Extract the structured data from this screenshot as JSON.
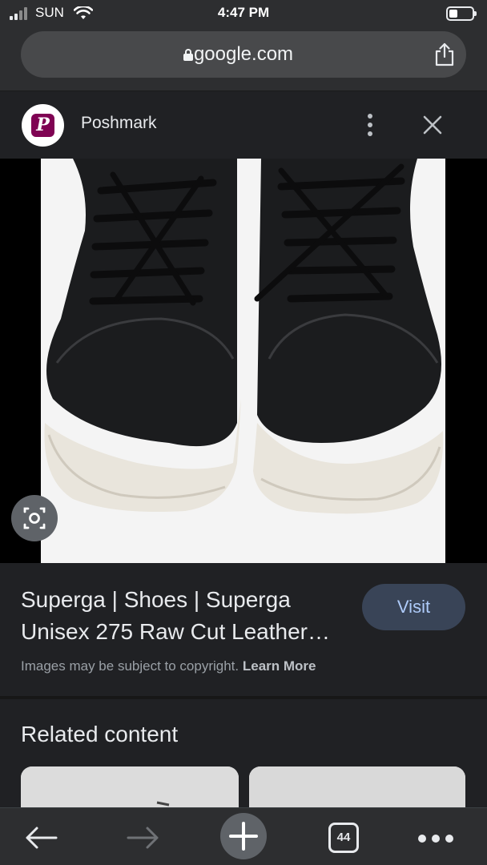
{
  "status_bar": {
    "carrier": "SUN",
    "time": "4:47 PM"
  },
  "address_bar": {
    "url": "google.com"
  },
  "source": {
    "name": "Poshmark",
    "logo_letter": "P",
    "brand_color": "#7f0353"
  },
  "image": {
    "subject": "black leather sneakers with white soles",
    "icon": "lens-icon"
  },
  "result": {
    "title_line1": "Superga | Shoes | Superga",
    "title_line2": "Unisex 275 Raw Cut Leather…",
    "visit_label": "Visit",
    "copyright_text": "Images may be subject to copyright.",
    "learn_more": "Learn More"
  },
  "related": {
    "heading": "Related content"
  },
  "toolbar": {
    "tab_count": "44"
  },
  "colors": {
    "background": "#202124",
    "visit_button": "#394457",
    "visit_text": "#aecbfa"
  }
}
